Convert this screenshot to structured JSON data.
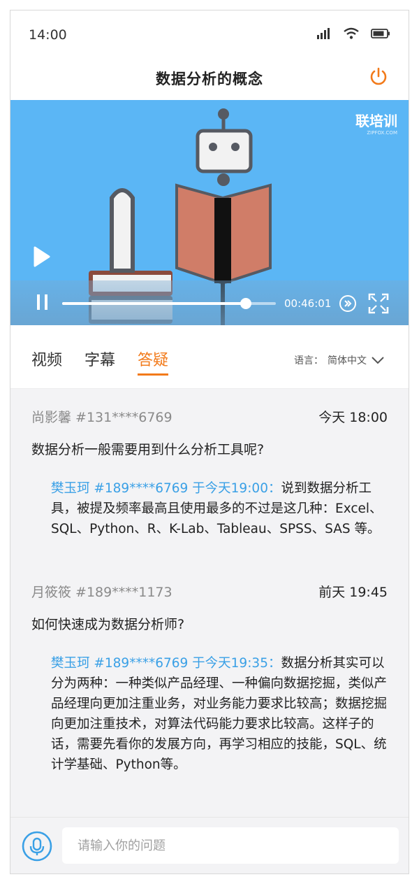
{
  "status_bar": {
    "time": "14:00"
  },
  "header": {
    "title": "数据分析的概念"
  },
  "video": {
    "watermark": "联培训",
    "watermark_sub": "ZIPFOX.COM",
    "current_time": "00:46:01",
    "progress": 0.86
  },
  "tabs": [
    {
      "label": "视频",
      "active": false
    },
    {
      "label": "字幕",
      "active": false
    },
    {
      "label": "答疑",
      "active": true
    }
  ],
  "language": {
    "label": "语言：",
    "value": "简体中文"
  },
  "qa": [
    {
      "user": "尚影馨 #131****6769",
      "date": "今天 18:00",
      "question": "数据分析一般需要用到什么分析工具呢?",
      "answer_by": "樊玉珂 #189****6769 于今天19:00：",
      "answer": "说到数据分析工具，被提及频率最高且使用最多的不过是这几种：Excel、SQL、Python、R、K-Lab、Tableau、SPSS、SAS 等。"
    },
    {
      "user": "月筱筱 #189****1173",
      "date": "前天 19:45",
      "question": "如何快速成为数据分析师?",
      "answer_by": "樊玉珂 #189****6769 于今天19:35：",
      "answer": "数据分析其实可以分为两种：一种类似产品经理、一种偏向数据挖掘，类似产品经理向更加注重业务，对业务能力要求比较高；数据挖掘向更加注重技术，对算法代码能力要求比较高。这样子的话，需要先看你的发展方向，再学习相应的技能，SQL、统计学基础、Python等。"
    }
  ],
  "input": {
    "placeholder": "请输入你的问题"
  },
  "colors": {
    "accent": "#f27a1a",
    "link": "#3aa0e6",
    "video_bg": "#5bb6f5"
  }
}
